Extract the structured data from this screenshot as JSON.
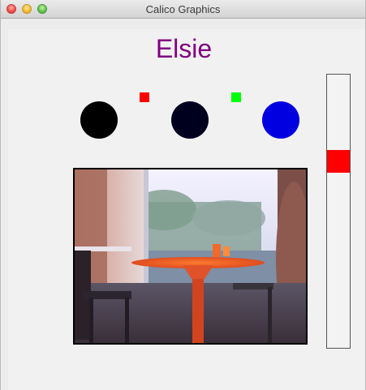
{
  "window": {
    "title": "Calico Graphics"
  },
  "robot": {
    "name": "Elsie"
  },
  "indicators": {
    "circles": [
      {
        "color": "#000000"
      },
      {
        "color": "#00001e"
      },
      {
        "color": "#0000e0"
      }
    ],
    "squares": [
      {
        "color": "#ff0000"
      },
      {
        "color": "#00ff00"
      }
    ]
  },
  "slider": {
    "level": 0.3,
    "thumb_color": "#ff0000"
  },
  "camera": {
    "content": "webcam-picture"
  }
}
